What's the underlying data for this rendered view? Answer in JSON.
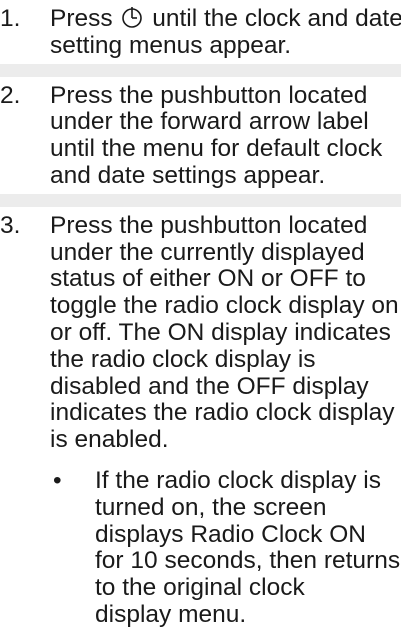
{
  "steps": [
    {
      "number": "1.",
      "line1_before": "Press ",
      "icon": "power-clock-icon",
      "line1_after": " until the clock and date",
      "lines": [
        "setting menus appear."
      ]
    },
    {
      "number": "2.",
      "lines": [
        "Press the pushbutton located",
        "under the forward arrow label",
        "until the menu for default clock",
        "and date settings appear."
      ]
    },
    {
      "number": "3.",
      "lines": [
        "Press the pushbutton located",
        "under the currently displayed",
        "status of either ON or OFF to",
        "toggle the radio clock display on",
        "or off. The ON display indicates",
        "the radio clock display is",
        "disabled and the OFF display",
        "indicates the radio clock display",
        "is enabled."
      ]
    }
  ],
  "bullet": {
    "symbol": "•",
    "lines": [
      "If the radio clock display is",
      "turned on, the screen",
      "displays Radio Clock ON",
      "for 10 seconds, then returns",
      "to the original clock",
      "display menu."
    ]
  }
}
